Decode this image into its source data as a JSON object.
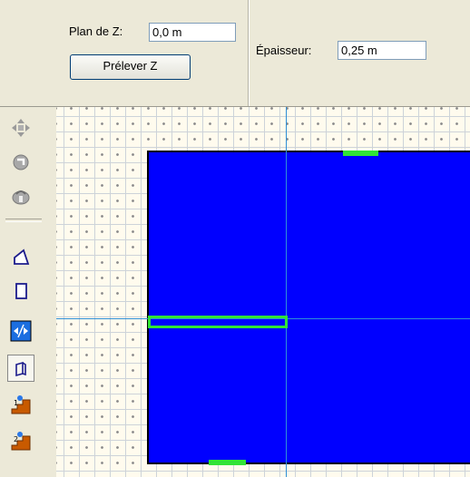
{
  "properties": {
    "plan_z_label": "Plan de Z:",
    "plan_z_value": "0,0 m",
    "pick_z_label": "Prélever Z",
    "thickness_label": "Épaisseur:",
    "thickness_value": "0,25 m"
  },
  "toolbar": {
    "tools": [
      {
        "name": "move",
        "icon": "move-arrows-icon",
        "active": false
      },
      {
        "name": "rotate",
        "icon": "rotate-icon",
        "active": false
      },
      {
        "name": "orbit",
        "icon": "orbit-icon",
        "active": false
      },
      {
        "name": "polygon",
        "icon": "polygon-outline-icon",
        "active": false
      },
      {
        "name": "rectangle",
        "icon": "rectangle-outline-icon",
        "active": false
      },
      {
        "name": "wall-split",
        "icon": "wall-split-icon",
        "active": false
      },
      {
        "name": "box-3d",
        "icon": "box-3d-icon",
        "active": true
      },
      {
        "name": "stairs-1",
        "icon": "stairs-1-icon",
        "active": false
      },
      {
        "name": "stairs-2",
        "icon": "stairs-2-icon",
        "active": false
      }
    ]
  },
  "colors": {
    "wall_fill": "#0000ff",
    "selection": "#31e337",
    "guide": "#2f8fd6",
    "canvas_bg": "#fffbee"
  }
}
